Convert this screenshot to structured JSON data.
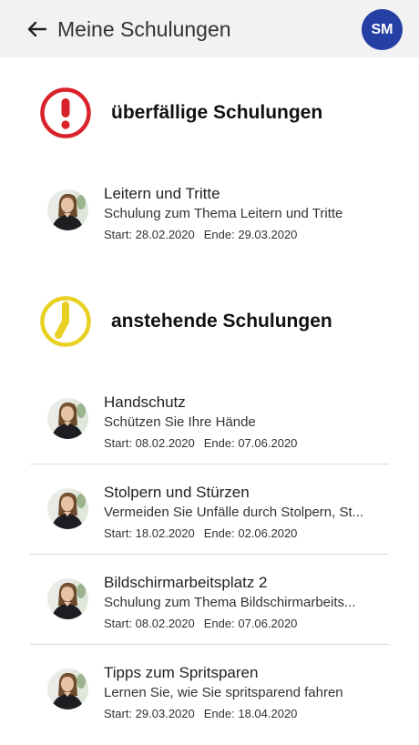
{
  "appbar": {
    "title": "Meine Schulungen",
    "avatar_initials": "SM",
    "avatar_color": "#2540a5"
  },
  "icons": {
    "back": "arrow-left-icon",
    "overdue": "exclamation-circle-icon",
    "upcoming": "clock-icon"
  },
  "colors": {
    "overdue": "#d8232a",
    "upcoming": "#e8d122"
  },
  "overdue": {
    "title": "überfällige Schulungen",
    "items": [
      {
        "title": "Leitern und Tritte",
        "subtitle": "Schulung zum Thema Leitern und Tritte",
        "start": "Start: 28.02.2020",
        "end": "Ende: 29.03.2020"
      }
    ]
  },
  "upcoming": {
    "title": "anstehende Schulungen",
    "items": [
      {
        "title": "Handschutz",
        "subtitle": "Schützen Sie Ihre Hände",
        "start": "Start: 08.02.2020",
        "end": "Ende: 07.06.2020"
      },
      {
        "title": "Stolpern und Stürzen",
        "subtitle": "Vermeiden Sie Unfälle durch Stolpern, St...",
        "start": "Start: 18.02.2020",
        "end": "Ende: 02.06.2020"
      },
      {
        "title": "Bildschirmarbeitsplatz 2",
        "subtitle": "Schulung zum Thema Bildschirmarbeits...",
        "start": "Start: 08.02.2020",
        "end": "Ende: 07.06.2020"
      },
      {
        "title": "Tipps zum Spritsparen",
        "subtitle": "Lernen Sie, wie Sie spritsparend fahren",
        "start": "Start: 29.03.2020",
        "end": "Ende: 18.04.2020"
      }
    ]
  }
}
